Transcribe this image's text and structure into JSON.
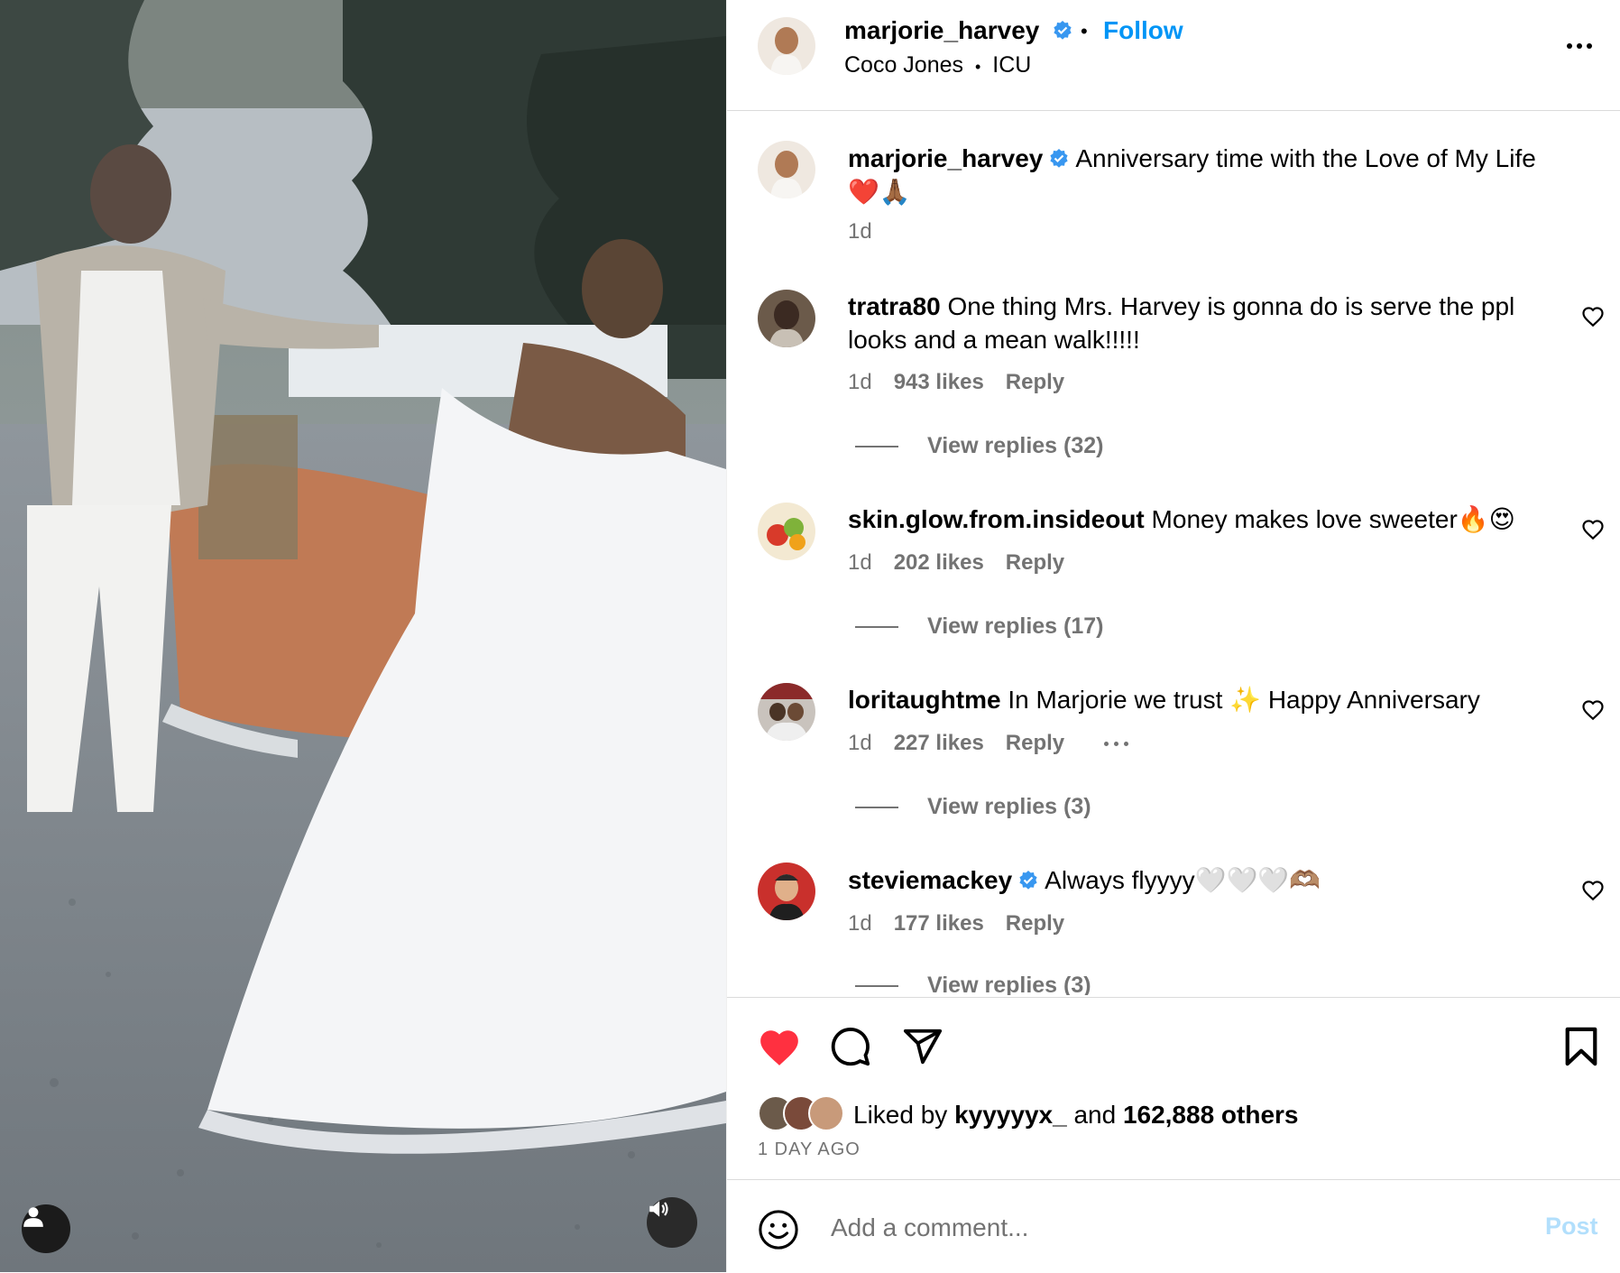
{
  "post": {
    "username": "marjorie_harvey",
    "follow_label": "Follow",
    "audio_artist": "Coco Jones",
    "audio_separator": "•",
    "audio_track": "ICU",
    "separator_dot": "•"
  },
  "caption": {
    "username": "marjorie_harvey",
    "text": "Anniversary time with the Love of My Life",
    "emojis": "❤️🙏🏾",
    "time": "1d"
  },
  "comments": [
    {
      "username": "tratra80",
      "text": "One thing Mrs. Harvey is gonna do is serve the ppl looks and a mean walk!!!!!",
      "time": "1d",
      "likes": "943 likes",
      "reply_label": "Reply",
      "view_replies": "View replies (32)"
    },
    {
      "username": "skin.glow.from.insideout",
      "text": "Money makes love sweeter🔥😍",
      "time": "1d",
      "likes": "202 likes",
      "reply_label": "Reply",
      "view_replies": "View replies (17)"
    },
    {
      "username": "loritaughtme",
      "text": "In Marjorie we trust ✨ Happy Anniversary",
      "time": "1d",
      "likes": "227 likes",
      "reply_label": "Reply",
      "view_replies": "View replies (3)"
    },
    {
      "username": "steviemackey",
      "text": "Always flyyyy🤍🤍🤍🫶🏽",
      "time": "1d",
      "likes": "177 likes",
      "reply_label": "Reply",
      "view_replies": "View replies (3)"
    }
  ],
  "likes": {
    "prefix": "Liked by",
    "user": "kyyyyyx_",
    "middle": "and",
    "count": "162,888 others"
  },
  "date_label": "1 DAY AGO",
  "add_comment": {
    "placeholder": "Add a comment...",
    "post_label": "Post"
  },
  "colors": {
    "accent": "#0095f6",
    "like_red": "#ff3040",
    "muted": "#737373",
    "post_disabled": "#b2dffc"
  }
}
